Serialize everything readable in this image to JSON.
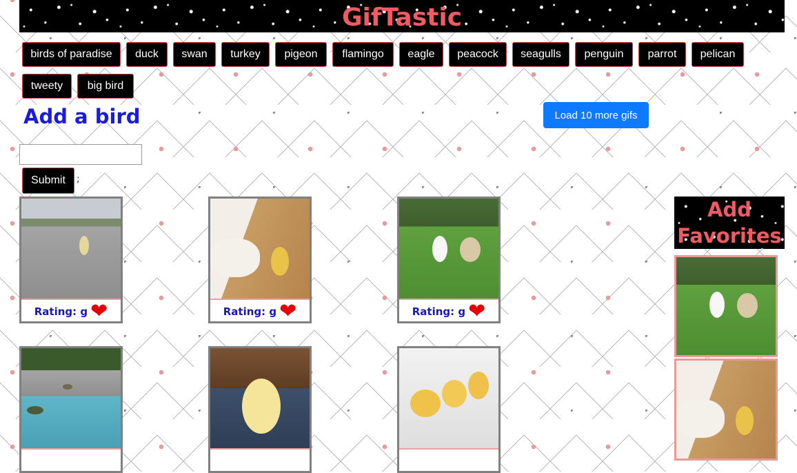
{
  "header": {
    "title": "GifTastic"
  },
  "birds": [
    "birds of paradise",
    "duck",
    "swan",
    "turkey",
    "pigeon",
    "flamingo",
    "eagle",
    "peacock",
    "seagulls",
    "penguin",
    "parrot",
    "pelican",
    "tweety",
    "big bird"
  ],
  "form": {
    "title": "Add a bird",
    "input_value": "",
    "submit_label": "Submit",
    "trailing_text": ";"
  },
  "load_more_label": "Load 10 more gifs",
  "gifs": [
    {
      "rating": "Rating: g",
      "scene": "duckling on road"
    },
    {
      "rating": "Rating: g",
      "scene": "dog and duckling on floor"
    },
    {
      "rating": "Rating: g",
      "scene": "duck and pug on grass"
    },
    {
      "scene": "ducks by pool"
    },
    {
      "scene": "duckling on person"
    },
    {
      "scene": "ducklings in tub"
    }
  ],
  "favorites": {
    "title": "Add Favorites",
    "items": [
      {
        "scene": "duck and pug on grass"
      },
      {
        "scene": "dog and duckling on floor"
      }
    ]
  },
  "colors": {
    "title_red": "#ef5b62",
    "heading_blue": "#1a1ae0",
    "rating_blue": "#1a1aa8",
    "load_button_blue": "#0d7aff",
    "heart_red": "#e60000"
  },
  "icons": {
    "favorite": "heart-icon"
  }
}
